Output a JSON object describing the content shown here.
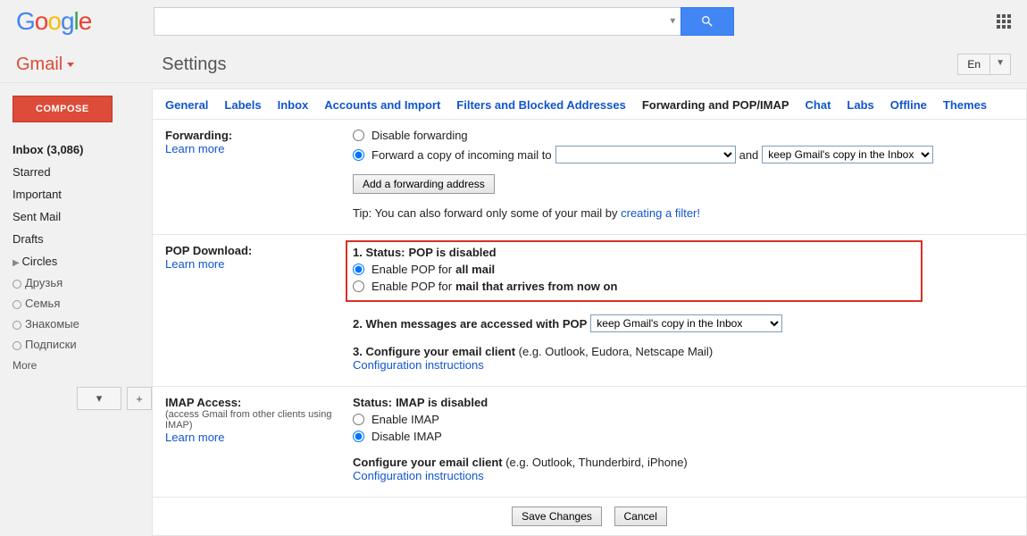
{
  "logo": {
    "g1": "G",
    "o1": "o",
    "o2": "o",
    "g2": "g",
    "l": "l",
    "e": "e"
  },
  "header": {
    "gmail": "Gmail",
    "settings": "Settings",
    "lang": "En"
  },
  "sidebar": {
    "compose": "COMPOSE",
    "inbox": "Inbox (3,086)",
    "starred": "Starred",
    "important": "Important",
    "sent": "Sent Mail",
    "drafts": "Drafts",
    "circles": "Circles",
    "c1": "Друзья",
    "c2": "Семья",
    "c3": "Знакомые",
    "c4": "Подписки",
    "more": "More",
    "plus": "+"
  },
  "tabs": {
    "general": "General",
    "labels": "Labels",
    "inbox": "Inbox",
    "accounts": "Accounts and Import",
    "filters": "Filters and Blocked Addresses",
    "forwarding": "Forwarding and POP/IMAP",
    "chat": "Chat",
    "labs": "Labs",
    "offline": "Offline",
    "themes": "Themes"
  },
  "fwd": {
    "title": "Forwarding:",
    "learn": "Learn more",
    "disable": "Disable forwarding",
    "forward_copy": "Forward a copy of incoming mail to",
    "and": "and",
    "keep": "keep Gmail's copy in the Inbox",
    "add_btn": "Add a forwarding address",
    "tip_prefix": "Tip: You can also forward only some of your mail by ",
    "tip_link": "creating a filter!"
  },
  "pop": {
    "title": "POP Download:",
    "learn": "Learn more",
    "status_prefix": "1. Status: ",
    "status_value": "POP is disabled",
    "enable_all_prefix": "Enable POP for ",
    "enable_all_bold": "all mail",
    "enable_now_prefix": "Enable POP for ",
    "enable_now_bold": "mail that arrives from now on",
    "accessed": "2. When messages are accessed with POP",
    "keep": "keep Gmail's copy in the Inbox",
    "configure_prefix": "3. Configure your email client ",
    "configure_eg": "(e.g. Outlook, Eudora, Netscape Mail)",
    "config_link": "Configuration instructions"
  },
  "imap": {
    "title": "IMAP Access:",
    "note": "(access Gmail from other clients using IMAP)",
    "learn": "Learn more",
    "status_prefix": "Status: ",
    "status_value": "IMAP is disabled",
    "enable": "Enable IMAP",
    "disable": "Disable IMAP",
    "configure_prefix": "Configure your email client ",
    "configure_eg": "(e.g. Outlook, Thunderbird, iPhone)",
    "config_link": "Configuration instructions"
  },
  "footer": {
    "save": "Save Changes",
    "cancel": "Cancel"
  }
}
